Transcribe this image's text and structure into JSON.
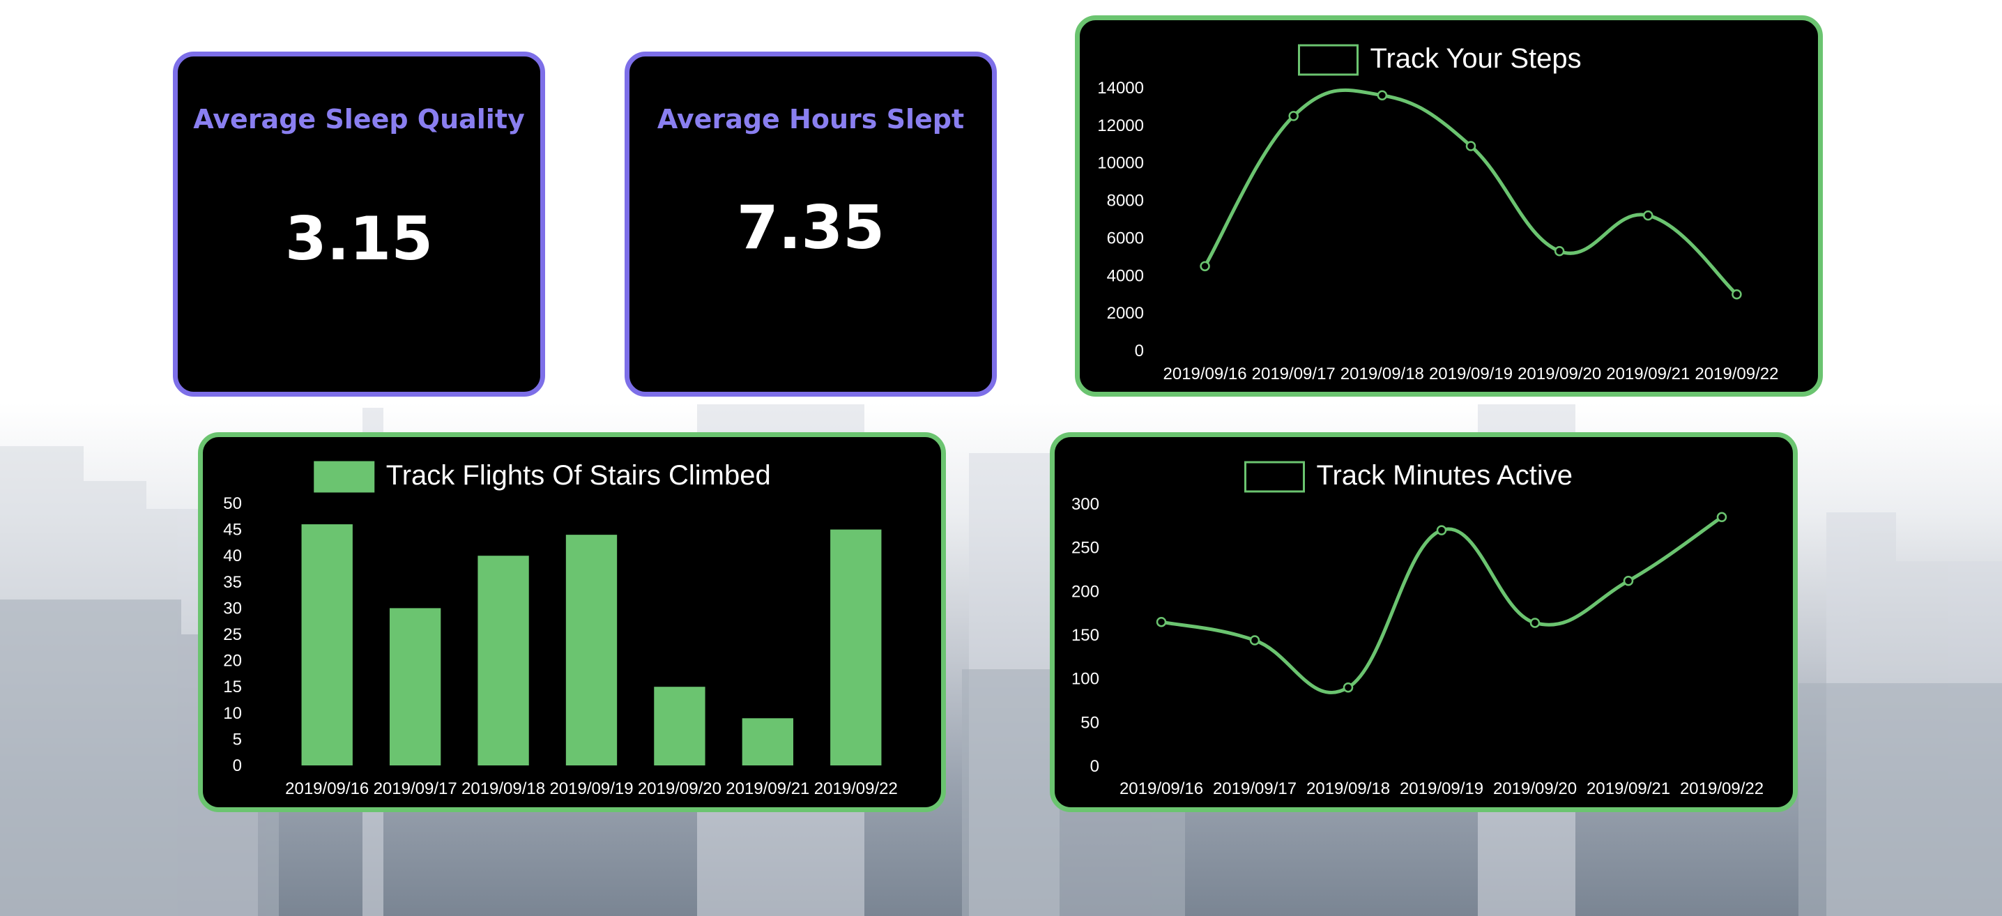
{
  "stats": {
    "sleep_quality": {
      "title": "Average Sleep Quality",
      "value": "3.15"
    },
    "hours_slept": {
      "title": "Average Hours Slept",
      "value": "7.35"
    }
  },
  "colors": {
    "stat_border": "#7d6fe8",
    "stat_title": "#8a7ff0",
    "chart_border": "#6bc470",
    "series": "#6bc470"
  },
  "chart_data": [
    {
      "id": "steps",
      "type": "line",
      "title": "Track Your Steps",
      "categories": [
        "2019/09/16",
        "2019/09/17",
        "2019/09/18",
        "2019/09/19",
        "2019/09/20",
        "2019/09/21",
        "2019/09/22"
      ],
      "series": [
        {
          "name": "Track Your Steps",
          "values": [
            4500,
            12500,
            13600,
            10900,
            5300,
            7200,
            3000
          ]
        }
      ],
      "ylim": [
        0,
        14000
      ],
      "yticks": [
        "0",
        "2000",
        "4000",
        "6000",
        "8000",
        "10000",
        "12000",
        "14000"
      ],
      "legend": "top"
    },
    {
      "id": "stairs",
      "type": "bar",
      "title": "Track Flights Of Stairs Climbed",
      "categories": [
        "2019/09/16",
        "2019/09/17",
        "2019/09/18",
        "2019/09/19",
        "2019/09/20",
        "2019/09/21",
        "2019/09/22"
      ],
      "series": [
        {
          "name": "Track Flights Of Stairs Climbed",
          "values": [
            46,
            30,
            40,
            44,
            15,
            9,
            45
          ]
        }
      ],
      "ylim": [
        0,
        50
      ],
      "yticks": [
        "0",
        "5",
        "10",
        "15",
        "20",
        "25",
        "30",
        "35",
        "40",
        "45",
        "50"
      ],
      "legend": "top"
    },
    {
      "id": "minutes",
      "type": "line",
      "title": "Track Minutes Active",
      "categories": [
        "2019/09/16",
        "2019/09/17",
        "2019/09/18",
        "2019/09/19",
        "2019/09/20",
        "2019/09/21",
        "2019/09/22"
      ],
      "series": [
        {
          "name": "Track Minutes Active",
          "values": [
            165,
            144,
            90,
            270,
            164,
            212,
            285
          ]
        }
      ],
      "ylim": [
        0,
        300
      ],
      "yticks": [
        "0",
        "50",
        "100",
        "150",
        "200",
        "250",
        "300"
      ],
      "legend": "top"
    }
  ]
}
